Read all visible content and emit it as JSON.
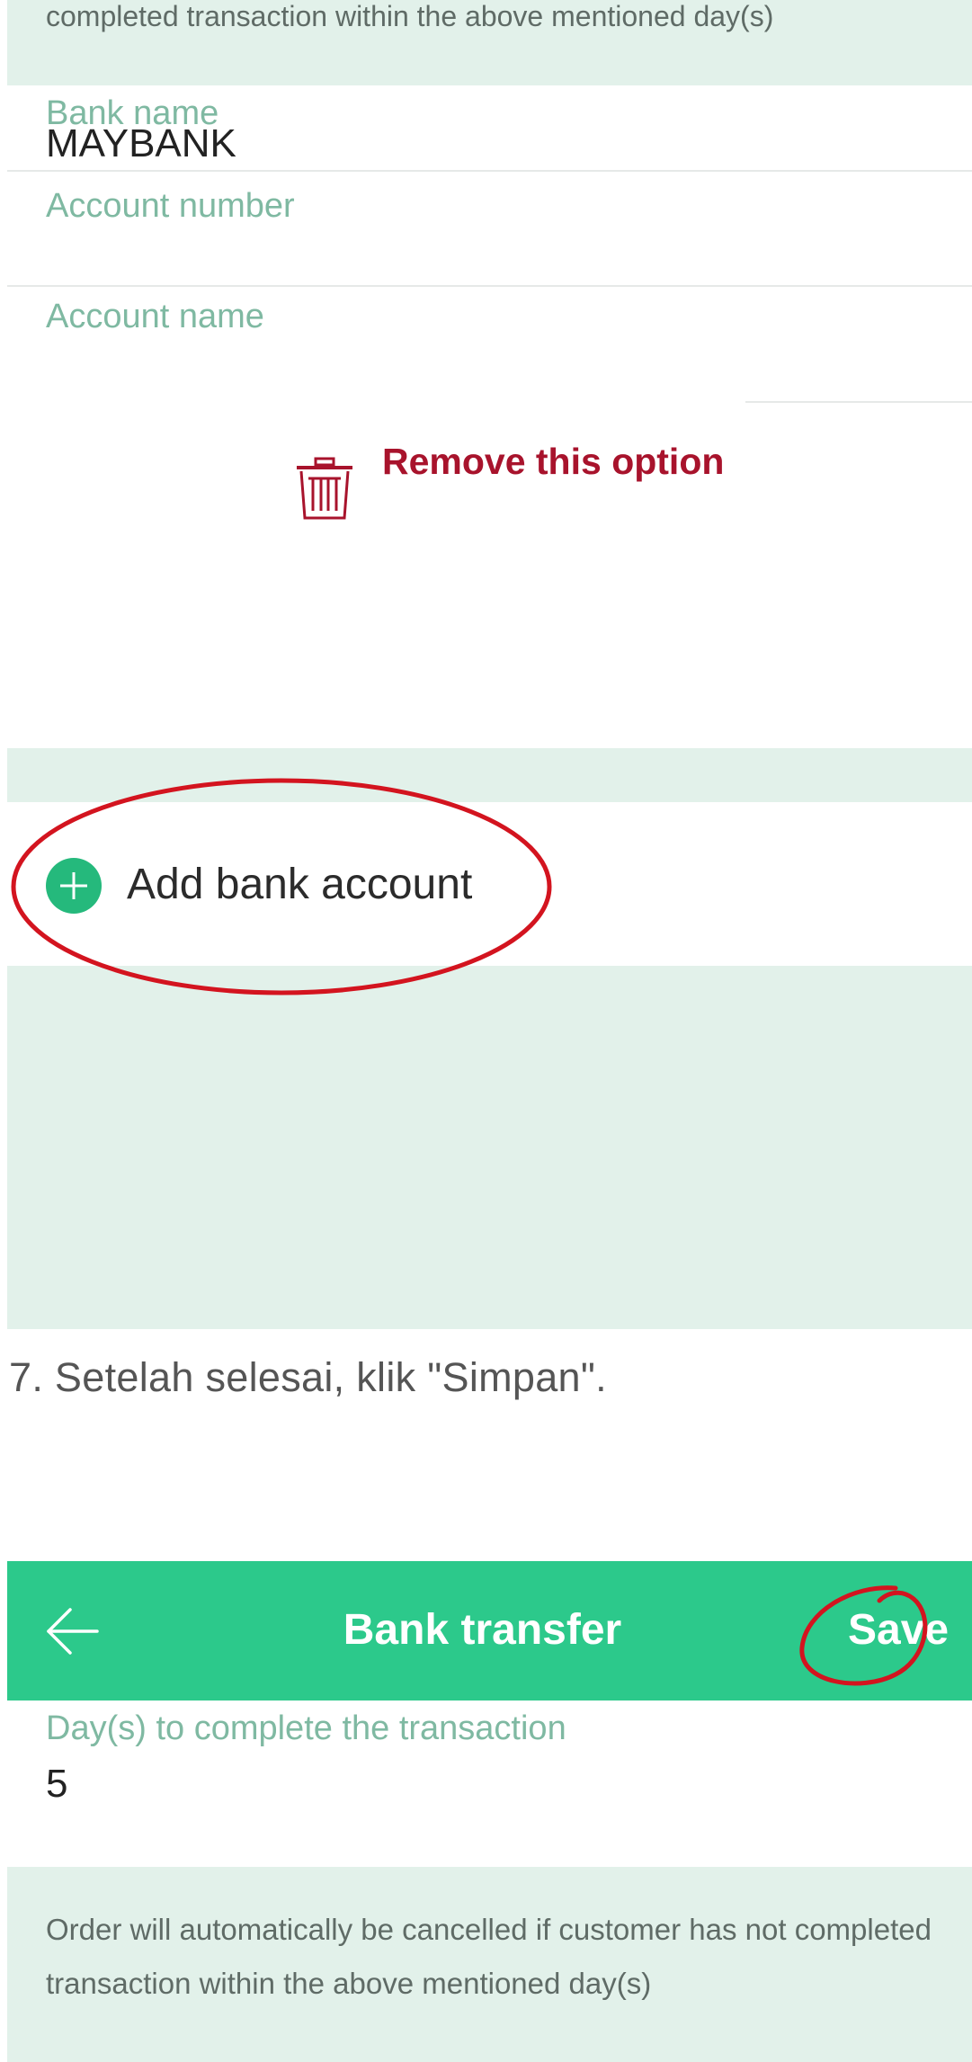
{
  "top_panel": {
    "notice_text": "completed transaction within the above mentioned day(s)",
    "bank_name": {
      "label": "Bank name",
      "value": "MAYBANK"
    },
    "account_number": {
      "label": "Account number",
      "value": ""
    },
    "account_name": {
      "label": "Account name",
      "value": ""
    },
    "remove_option_label": "Remove this option",
    "add_bank_account_label": "Add bank account"
  },
  "caption": "7. Setelah selesai, klik \"Simpan\".",
  "bottom_panel": {
    "header": {
      "title": "Bank transfer",
      "save_label": "Save"
    },
    "days_field": {
      "label": "Day(s) to complete the transaction",
      "value": "5"
    },
    "notice_text": "Order will automatically be cancelled if customer has not completed transaction within the above mentioned day(s)"
  },
  "colors": {
    "app_green": "#2cc98b",
    "notice_bg": "#e2f1ea",
    "label_green": "#7fb9a2",
    "remove_red": "#a8132c",
    "annotation_red": "#d3141f"
  },
  "icons": [
    "trash-icon",
    "plus-circle-icon",
    "back-arrow-icon"
  ]
}
